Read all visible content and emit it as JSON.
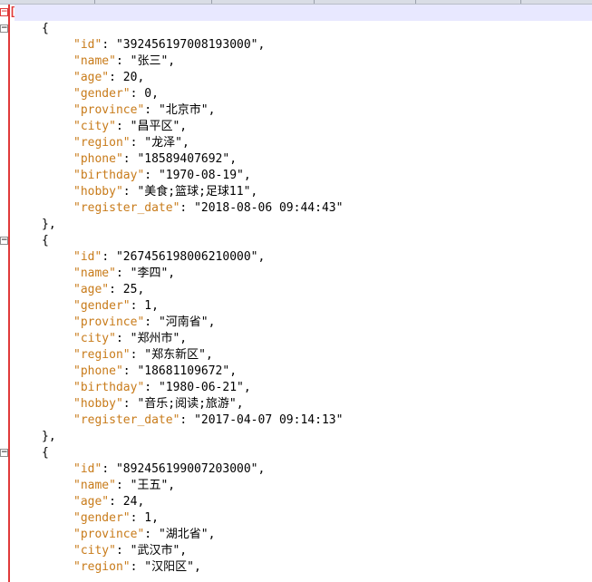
{
  "editor": {
    "open_bracket": "[",
    "records": [
      {
        "fields": [
          {
            "key": "\"id\"",
            "sep": ": ",
            "value": "\"392456197008193000\"",
            "tail": ","
          },
          {
            "key": "\"name\"",
            "sep": ": ",
            "value": "\"张三\"",
            "tail": ","
          },
          {
            "key": "\"age\"",
            "sep": ": ",
            "value": "20",
            "tail": ","
          },
          {
            "key": "\"gender\"",
            "sep": ": ",
            "value": "0",
            "tail": ","
          },
          {
            "key": "\"province\"",
            "sep": ": ",
            "value": "\"北京市\"",
            "tail": ","
          },
          {
            "key": "\"city\"",
            "sep": ": ",
            "value": "\"昌平区\"",
            "tail": ","
          },
          {
            "key": "\"region\"",
            "sep": ": ",
            "value": "\"龙泽\"",
            "tail": ","
          },
          {
            "key": "\"phone\"",
            "sep": ": ",
            "value": "\"18589407692\"",
            "tail": ","
          },
          {
            "key": "\"birthday\"",
            "sep": ": ",
            "value": "\"1970-08-19\"",
            "tail": ","
          },
          {
            "key": "\"hobby\"",
            "sep": ": ",
            "value": "\"美食;篮球;足球11\"",
            "tail": ","
          },
          {
            "key": "\"register_date\"",
            "sep": ": ",
            "value": "\"2018-08-06 09:44:43\"",
            "tail": ""
          }
        ],
        "close": "},"
      },
      {
        "fields": [
          {
            "key": "\"id\"",
            "sep": ": ",
            "value": "\"267456198006210000\"",
            "tail": ","
          },
          {
            "key": "\"name\"",
            "sep": ": ",
            "value": "\"李四\"",
            "tail": ","
          },
          {
            "key": "\"age\"",
            "sep": ": ",
            "value": "25",
            "tail": ","
          },
          {
            "key": "\"gender\"",
            "sep": ": ",
            "value": "1",
            "tail": ","
          },
          {
            "key": "\"province\"",
            "sep": ": ",
            "value": "\"河南省\"",
            "tail": ","
          },
          {
            "key": "\"city\"",
            "sep": ": ",
            "value": "\"郑州市\"",
            "tail": ","
          },
          {
            "key": "\"region\"",
            "sep": ": ",
            "value": "\"郑东新区\"",
            "tail": ","
          },
          {
            "key": "\"phone\"",
            "sep": ": ",
            "value": "\"18681109672\"",
            "tail": ","
          },
          {
            "key": "\"birthday\"",
            "sep": ": ",
            "value": "\"1980-06-21\"",
            "tail": ","
          },
          {
            "key": "\"hobby\"",
            "sep": ": ",
            "value": "\"音乐;阅读;旅游\"",
            "tail": ","
          },
          {
            "key": "\"register_date\"",
            "sep": ": ",
            "value": "\"2017-04-07 09:14:13\"",
            "tail": ""
          }
        ],
        "close": "},"
      },
      {
        "fields": [
          {
            "key": "\"id\"",
            "sep": ": ",
            "value": "\"892456199007203000\"",
            "tail": ","
          },
          {
            "key": "\"name\"",
            "sep": ": ",
            "value": "\"王五\"",
            "tail": ","
          },
          {
            "key": "\"age\"",
            "sep": ": ",
            "value": "24",
            "tail": ","
          },
          {
            "key": "\"gender\"",
            "sep": ": ",
            "value": "1",
            "tail": ","
          },
          {
            "key": "\"province\"",
            "sep": ": ",
            "value": "\"湖北省\"",
            "tail": ","
          },
          {
            "key": "\"city\"",
            "sep": ": ",
            "value": "\"武汉市\"",
            "tail": ","
          },
          {
            "key": "\"region\"",
            "sep": ": ",
            "value": "\"汉阳区\"",
            "tail": ","
          }
        ],
        "close": null
      }
    ],
    "open_brace": "{",
    "fold_minus": "−"
  },
  "colors": {
    "key": "#c87b1a",
    "bracket_active": "#e03a3a",
    "current_line_bg": "#e8e8ff"
  }
}
